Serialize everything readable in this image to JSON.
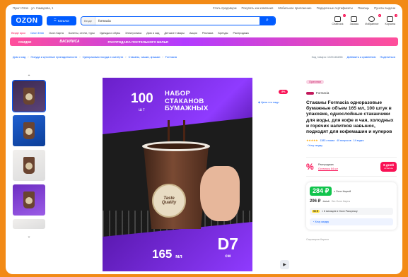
{
  "topbar": {
    "location": "Пункт Ozon · ул. Самарова, 1",
    "links": [
      "Стать продавцом",
      "Покупать как компания",
      "Мобильное приложение",
      "Подарочные сертификаты",
      "Помощь",
      "Пункты выдачи"
    ]
  },
  "header": {
    "logo": "OZON",
    "catalog_label": "Каталог",
    "search_scope": "Везде",
    "search_query": "formacia",
    "search_icon": "search-icon",
    "actions": [
      {
        "label": "Chatbook",
        "badge": "1"
      },
      {
        "label": "Заказы",
        "badge": ""
      },
      {
        "label": "Избранное",
        "badge": "1"
      },
      {
        "label": "Корзина",
        "badge": "1"
      }
    ]
  },
  "catnav": {
    "items": [
      "Везде ярко",
      "Ozon fresh",
      "Ozon Карта",
      "Билеты, отели, туры",
      "Одежда и обувь",
      "Электроника",
      "Дом и сад",
      "Детские товары",
      "Акции",
      "Реклама",
      "Бренды",
      "Распродажа"
    ]
  },
  "promo": {
    "left": "СКИДКИ",
    "center": "ВАСИЛИСА",
    "right": "РАСПРОДАЖА ПОСТЕЛЬНОГО БЕЛЬЯ"
  },
  "breadcrumbs": {
    "items": [
      "Дом и сад",
      "Посуда и кухонные принадлежности",
      "Одноразовая посуда и скатерти",
      "Стаканы, чашки, крышки",
      "Formacia"
    ],
    "article": "Код товара: 1025181858",
    "compare": "Добавить к сравнению",
    "share": "Поделиться"
  },
  "gallery": {
    "up_icon": "chevron-up-icon",
    "down_icon": "chevron-down-icon",
    "thumb_count": 5
  },
  "photo": {
    "count": "100",
    "unit": "шт",
    "title_lines": [
      "НАБОР",
      "СТАКАНОВ",
      "БУМАЖНЫХ"
    ],
    "brand_on_cup_1": "Taste",
    "brand_on_cup_2": "Quality",
    "volume": "165",
    "volume_unit": "мл",
    "size": "D7",
    "size_unit": "см"
  },
  "side": {
    "discount": "-9%",
    "price_link": "Цена что надо"
  },
  "info": {
    "original_badge": "Оригинал",
    "brand": "Formacia",
    "title": "Стаканы Formacia одноразовые бумажные объем 165 мл, 100 штук в упаковке, однослойные стаканчики для воды, для кофе и чая, холодных и горячих напитков навынос, подходят для кофемашин и кулеров",
    "rating_stars": "★★★★★",
    "rating_value": "4.9",
    "reviews": "1383 отзыва",
    "questions": "40 вопросов",
    "videos": "14 видео",
    "ask": "Хочу скидку",
    "split_label": "Распродажа",
    "split_sub": "Осталось 84 шт",
    "split_btn": "6 дней",
    "split_btn_sub": "осталось",
    "price": "284 ₽",
    "price_note": "с Ozon Картой",
    "old_price": "296 ₽",
    "old_price_crossed": "310 ₽",
    "old_price_note": "без Ozon Карты",
    "bnpl_chip": "56 ₽",
    "bnpl_text": "× 6 месяцев в Ozon Рассрочку",
    "wait": "Хочу скидку",
    "seller": "Сыроваров Кирилл"
  }
}
